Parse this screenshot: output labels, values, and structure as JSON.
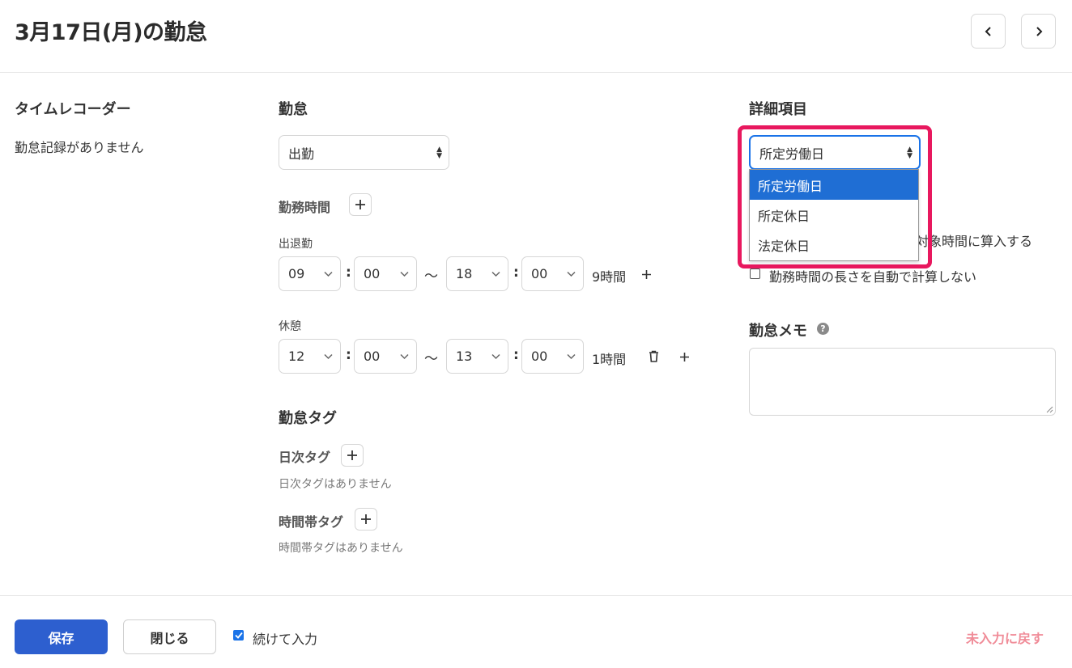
{
  "header": {
    "title": "3月17日(月)の勤怠"
  },
  "timerecorder": {
    "heading": "タイムレコーダー",
    "empty": "勤怠記録がありません"
  },
  "attendance": {
    "heading": "勤怠",
    "type_select": "出勤",
    "work_time_label": "勤務時間",
    "shift_label": "出退勤",
    "shift": {
      "start_h": "09",
      "start_m": "00",
      "tilde": "〜",
      "end_h": "18",
      "end_m": "00",
      "duration": "9時間"
    },
    "break_label": "休憩",
    "break": {
      "start_h": "12",
      "start_m": "00",
      "tilde": "〜",
      "end_h": "13",
      "end_m": "00",
      "duration": "1時間"
    },
    "colon": ":"
  },
  "tags": {
    "heading": "勤怠タグ",
    "daily_label": "日次タグ",
    "daily_empty": "日次タグはありません",
    "timeband_label": "時間帯タグ",
    "timeband_empty": "時間帯タグはありません"
  },
  "details": {
    "heading": "詳細項目",
    "select_value": "所定労働日",
    "options": [
      "所定労働日",
      "所定休日",
      "法定休日"
    ],
    "partial_option_text": "対象時間に算入する",
    "auto_calc_label": "勤務時間の長さを自動で計算しない"
  },
  "memo": {
    "heading": "勤怠メモ",
    "help": "?"
  },
  "footer": {
    "save": "保存",
    "close": "閉じる",
    "continue_label": "続けて入力",
    "reset": "未入力に戻す"
  },
  "colors": {
    "accent": "#2d5fcf",
    "highlight": "#e8185e",
    "reset_link": "#f08c98",
    "dropdown_selected": "#1f6ed4"
  }
}
